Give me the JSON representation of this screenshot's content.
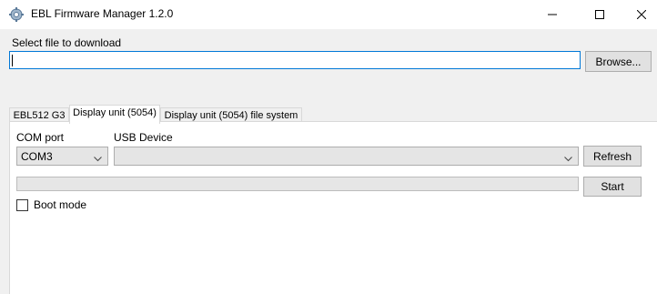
{
  "window": {
    "title": "EBL Firmware Manager 1.2.0",
    "icons": {
      "app": "firmware-manager-icon",
      "minimize": "minimize-icon",
      "maximize": "maximize-icon",
      "close": "close-icon"
    }
  },
  "file": {
    "label": "Select file to download",
    "value": "",
    "browse_label": "Browse..."
  },
  "tabs": [
    {
      "label": "EBL512 G3",
      "active": false
    },
    {
      "label": "Display unit (5054)",
      "active": true
    },
    {
      "label": "Display unit (5054) file system",
      "active": false
    }
  ],
  "panel": {
    "com_port_label": "COM port",
    "com_port_value": "COM3",
    "usb_device_label": "USB Device",
    "usb_device_value": "",
    "refresh_label": "Refresh",
    "start_label": "Start",
    "boot_mode_label": "Boot mode",
    "boot_mode_checked": false,
    "progress": 0
  },
  "colors": {
    "focus_border": "#0078d7",
    "button_bg": "#e1e1e1",
    "window_bg": "#f0f0f0"
  }
}
